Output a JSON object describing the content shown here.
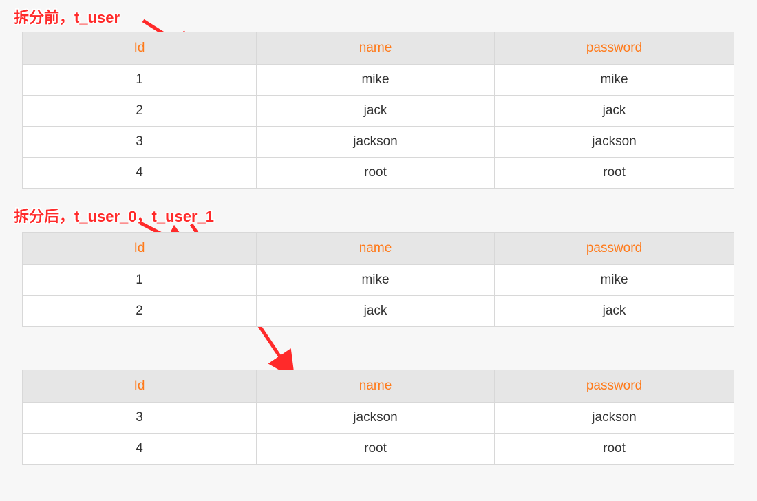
{
  "labels": {
    "before": "拆分前，t_user",
    "after": "拆分后，t_user_0，t_user_1"
  },
  "columns": {
    "id": "Id",
    "name": "name",
    "password": "password"
  },
  "tables": {
    "before": {
      "rows": [
        {
          "id": "1",
          "name": "mike",
          "password": "mike"
        },
        {
          "id": "2",
          "name": "jack",
          "password": "jack"
        },
        {
          "id": "3",
          "name": "jackson",
          "password": "jackson"
        },
        {
          "id": "4",
          "name": "root",
          "password": "root"
        }
      ]
    },
    "split0": {
      "rows": [
        {
          "id": "1",
          "name": "mike",
          "password": "mike"
        },
        {
          "id": "2",
          "name": "jack",
          "password": "jack"
        }
      ]
    },
    "split1": {
      "rows": [
        {
          "id": "3",
          "name": "jackson",
          "password": "jackson"
        },
        {
          "id": "4",
          "name": "root",
          "password": "root"
        }
      ]
    }
  },
  "colors": {
    "header_text": "#ff7a1a",
    "arrow": "#ff2a2a"
  }
}
